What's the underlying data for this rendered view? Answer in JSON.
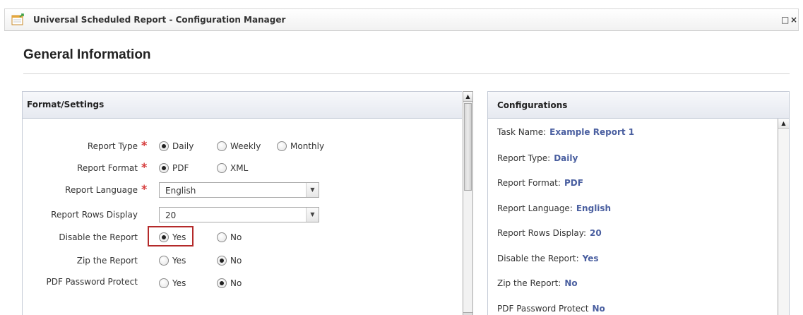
{
  "window": {
    "title": "Universal Scheduled Report - Configuration Manager",
    "maximize_glyph": "□",
    "close_glyph": "×"
  },
  "section": {
    "title": "General Information"
  },
  "format_panel": {
    "title": "Format/Settings",
    "rows": [
      {
        "label": "Report Type",
        "required": true,
        "options": [
          "Daily",
          "Weekly",
          "Monthly"
        ],
        "selected": "Daily"
      },
      {
        "label": "Report Format",
        "required": true,
        "options": [
          "PDF",
          "XML"
        ],
        "selected": "PDF"
      },
      {
        "label": "Report Language",
        "required": true,
        "value": "English"
      },
      {
        "label": "Report Rows Display",
        "required": false,
        "value": "20"
      },
      {
        "label": "Disable the Report",
        "required": false,
        "options": [
          "Yes",
          "No"
        ],
        "selected": "Yes"
      },
      {
        "label": "Zip the Report",
        "required": false,
        "options": [
          "Yes",
          "No"
        ],
        "selected": "No"
      },
      {
        "label": "PDF Password Protect",
        "required": false,
        "options": [
          "Yes",
          "No"
        ],
        "selected": "No"
      }
    ],
    "required_marker": "*"
  },
  "config_panel": {
    "title": "Configurations",
    "items": [
      {
        "label": "Task Name:",
        "value": "Example Report 1"
      },
      {
        "label": "Report Type:",
        "value": "Daily"
      },
      {
        "label": "Report Format:",
        "value": "PDF"
      },
      {
        "label": "Report Language:",
        "value": "English"
      },
      {
        "label": "Report Rows Display:",
        "value": "20"
      },
      {
        "label": "Disable the Report:",
        "value": "Yes"
      },
      {
        "label": "Zip the Report:",
        "value": "No"
      },
      {
        "label": "PDF Password Protect",
        "value": "No"
      }
    ]
  },
  "colors": {
    "required": "#d63b3b",
    "highlight": "#b42a2a",
    "config_value": "#4a5fa0"
  },
  "icons": {
    "app": "report-icon",
    "scroll_up": "scroll-up-arrow-icon",
    "dropdown": "chevron-down-icon"
  }
}
